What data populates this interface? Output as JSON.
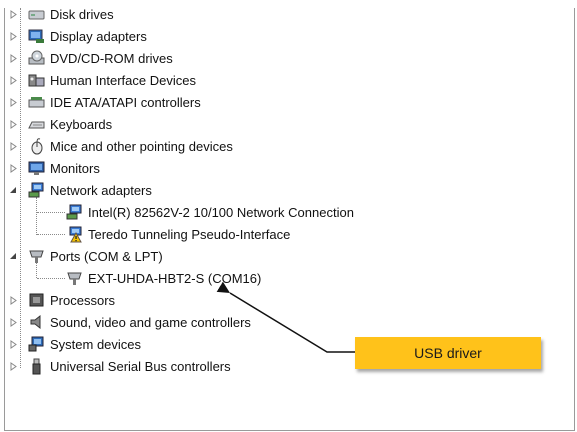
{
  "tree": {
    "categories": [
      {
        "label": "Disk drives",
        "icon": "disk-drive-icon",
        "expanded": false
      },
      {
        "label": "Display adapters",
        "icon": "display-adapter-icon",
        "expanded": false
      },
      {
        "label": "DVD/CD-ROM drives",
        "icon": "dvd-drive-icon",
        "expanded": false
      },
      {
        "label": "Human Interface Devices",
        "icon": "hid-icon",
        "expanded": false
      },
      {
        "label": "IDE ATA/ATAPI controllers",
        "icon": "ide-controller-icon",
        "expanded": false
      },
      {
        "label": "Keyboards",
        "icon": "keyboard-icon",
        "expanded": false
      },
      {
        "label": "Mice and other pointing devices",
        "icon": "mouse-icon",
        "expanded": false
      },
      {
        "label": "Monitors",
        "icon": "monitor-icon",
        "expanded": false
      },
      {
        "label": "Network adapters",
        "icon": "network-adapter-icon",
        "expanded": true
      },
      {
        "label": "Ports (COM & LPT)",
        "icon": "port-icon",
        "expanded": true
      },
      {
        "label": "Processors",
        "icon": "processor-icon",
        "expanded": false
      },
      {
        "label": "Sound, video and game controllers",
        "icon": "sound-icon",
        "expanded": false
      },
      {
        "label": "System devices",
        "icon": "system-device-icon",
        "expanded": false
      },
      {
        "label": "Universal Serial Bus controllers",
        "icon": "usb-icon",
        "expanded": false
      }
    ],
    "network_children": [
      {
        "label": "Intel(R) 82562V-2 10/100 Network Connection",
        "icon": "network-adapter-icon",
        "warning": false
      },
      {
        "label": "Teredo Tunneling Pseudo-Interface",
        "icon": "network-adapter-icon",
        "warning": true
      }
    ],
    "ports_children": [
      {
        "label": "EXT-UHDA-HBT2-S (COM16)",
        "icon": "port-icon"
      }
    ]
  },
  "callout": {
    "label": "USB driver",
    "color": "#ffc21a"
  }
}
